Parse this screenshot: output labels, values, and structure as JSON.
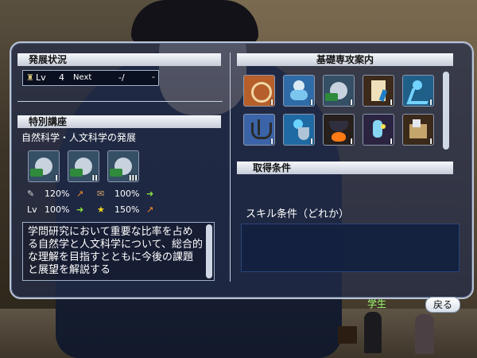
{
  "left": {
    "section1_title": "発展状況",
    "level": {
      "label": "Lv",
      "value": "4",
      "next_label": "Next",
      "next_value": "-/",
      "extra": "-"
    },
    "section2_title": "特別講座",
    "course_name": "自然科学・人文科学の発展",
    "course_icons": [
      {
        "name": "book-globe-icon",
        "badge": "I"
      },
      {
        "name": "book-globe-icon",
        "badge": "II"
      },
      {
        "name": "book-globe-icon",
        "badge": "III"
      }
    ],
    "stats": [
      {
        "icon": "quill-icon",
        "value": "120%",
        "arrow": "up"
      },
      {
        "icon": "scroll-icon",
        "value": "100%",
        "arrow": "right"
      },
      {
        "icon": "lv-icon",
        "label": "Lv",
        "value": "100%",
        "arrow": "right"
      },
      {
        "icon": "star-icon",
        "value": "150%",
        "arrow": "up"
      }
    ],
    "description": "学問研究において重要な比率を占める自然学と人文科学について、総合的な理解を目指すとともに今後の課題と展望を解説する"
  },
  "right": {
    "panel_title": "基礎専攻案内",
    "skills": [
      {
        "name": "ship-wheel-icon",
        "badge": "I"
      },
      {
        "name": "person-bag-icon",
        "badge": "I"
      },
      {
        "name": "book-globe-icon",
        "badge": "I"
      },
      {
        "name": "scroll-quill-icon",
        "badge": "I"
      },
      {
        "name": "running-man-icon",
        "badge": "I"
      },
      {
        "name": "anchor-wave-icon",
        "badge": "I"
      },
      {
        "name": "person-shield-icon",
        "badge": "I"
      },
      {
        "name": "cauldron-fire-icon",
        "badge": "I"
      },
      {
        "name": "potion-icon",
        "badge": "I"
      },
      {
        "name": "box-items-icon",
        "badge": "I"
      }
    ],
    "cond_title": "取得条件",
    "skill_cond": "スキル条件（どれか）"
  },
  "footer": {
    "status_label": "学生",
    "back_label": "戻る"
  }
}
